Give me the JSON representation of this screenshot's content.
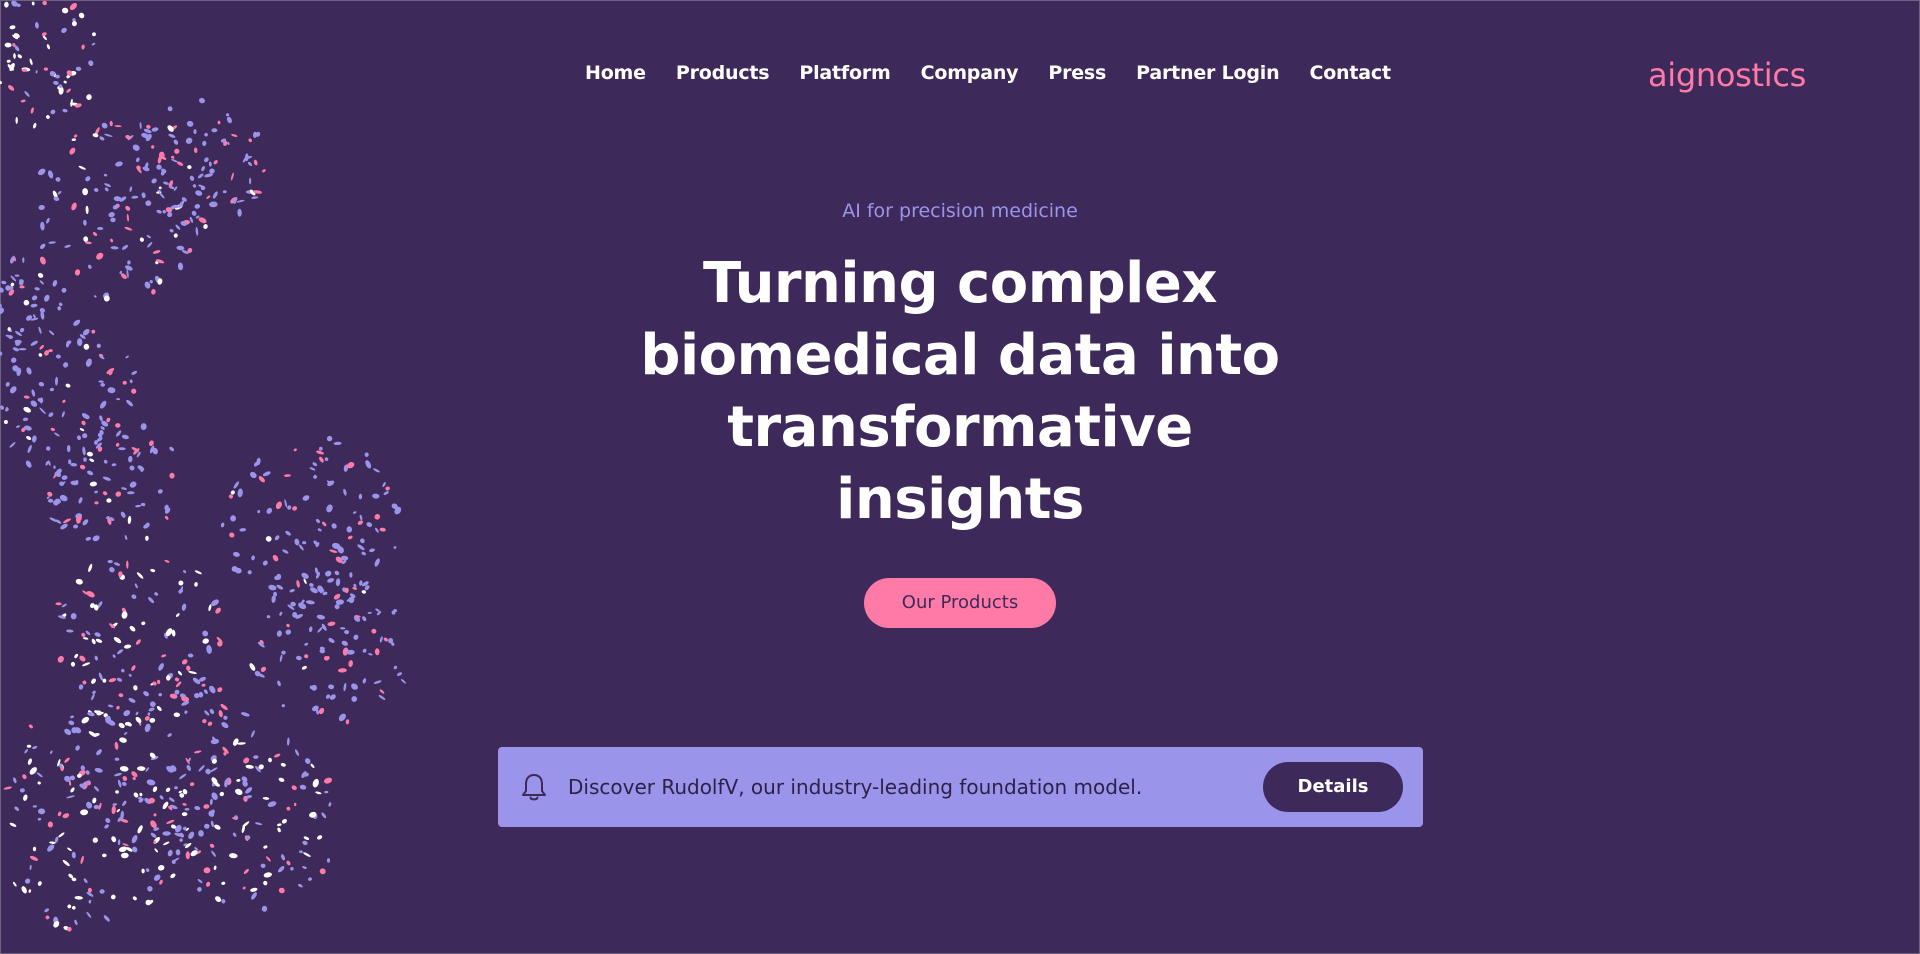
{
  "nav": {
    "items": [
      {
        "label": "Home"
      },
      {
        "label": "Products"
      },
      {
        "label": "Platform"
      },
      {
        "label": "Company"
      },
      {
        "label": "Press"
      },
      {
        "label": "Partner Login"
      },
      {
        "label": "Contact"
      }
    ]
  },
  "brand": {
    "name": "aignostics"
  },
  "hero": {
    "eyebrow": "AI for precision medicine",
    "headline": "Turning complex biomedical data into transformative insights",
    "cta_label": "Our Products"
  },
  "announcement": {
    "icon": "bell-icon",
    "text": "Discover RudolfV, our industry-leading foundation model.",
    "button_label": "Details"
  },
  "colors": {
    "background": "#3d2a5a",
    "accent_pink": "#ff7aa6",
    "accent_lavender": "#9a94ea",
    "text": "#ffffff"
  }
}
